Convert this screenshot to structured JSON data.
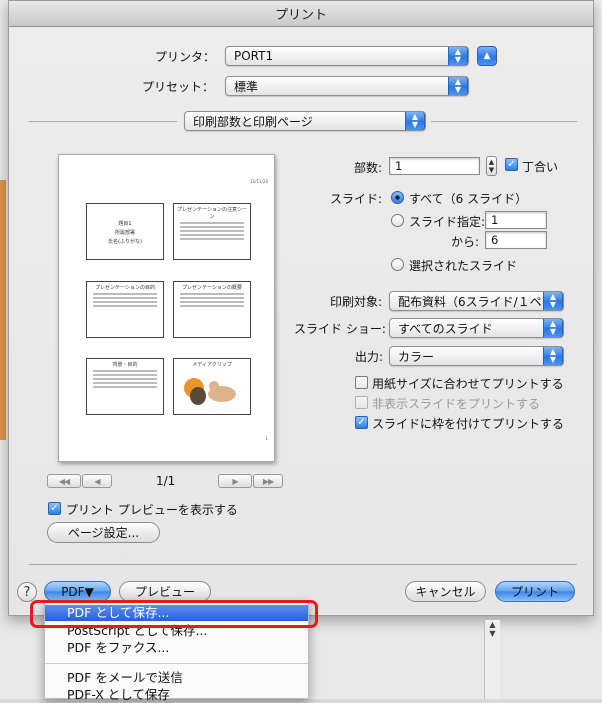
{
  "dialog": {
    "title": "プリント"
  },
  "printer": {
    "label": "プリンタ：",
    "value": "PORT1"
  },
  "preset": {
    "label": "プリセット：",
    "value": "標準"
  },
  "panel_select": {
    "value": "印刷部数と印刷ページ"
  },
  "copies": {
    "label": "部数:",
    "value": "1",
    "collate_label": "丁合い",
    "collate_checked": true
  },
  "slides": {
    "label": "スライド:",
    "all_label": "すべて（6 スライド）",
    "range_label": "スライド指定:",
    "range_from": "1",
    "range_to_label": "から:",
    "range_to": "6",
    "selected_label": "選択されたスライド"
  },
  "print_what": {
    "label": "印刷対象:",
    "value": "配布資料（6スライド/１ペ…"
  },
  "slideshow": {
    "label": "スライド ショー:",
    "value": "すべてのスライド"
  },
  "output": {
    "label": "出力:",
    "value": "カラー"
  },
  "options": [
    {
      "label": "用紙サイズに合わせてプリントする",
      "checked": false,
      "enabled": true
    },
    {
      "label": "非表示スライドをプリントする",
      "checked": false,
      "enabled": false
    },
    {
      "label": "スライドに枠を付けてプリントする",
      "checked": true,
      "enabled": true
    }
  ],
  "preview": {
    "page_indicator": "1/1",
    "show_preview_label": "プリント プレビューを表示する",
    "page_setup_button": "ページ設定...",
    "date": "11/11/20",
    "page_number": "1",
    "thumbs": [
      {
        "title": "題目1",
        "sub": "所属部署",
        "sub2": "氏名(ふりがな)"
      },
      {
        "title": "プレゼンテーションの注意シーン"
      },
      {
        "title": "プレゼンテーションの目的"
      },
      {
        "title": "プレゼンテーションの概要"
      },
      {
        "title": "背景・目的"
      },
      {
        "title": "メディアクリップ"
      }
    ]
  },
  "footer": {
    "help": "?",
    "pdf_button": "PDF▼",
    "preview_button": "プレビュー",
    "cancel_button": "キャンセル",
    "print_button": "プリント"
  },
  "pdf_menu": {
    "items": [
      "PDF として保存...",
      "PostScript として保存...",
      "PDF をファクス...",
      "PDF をメールで送信",
      "PDF-X として保存"
    ]
  },
  "colors": {
    "accent": "#2a78e6",
    "highlight_border": "#e41b1b"
  }
}
